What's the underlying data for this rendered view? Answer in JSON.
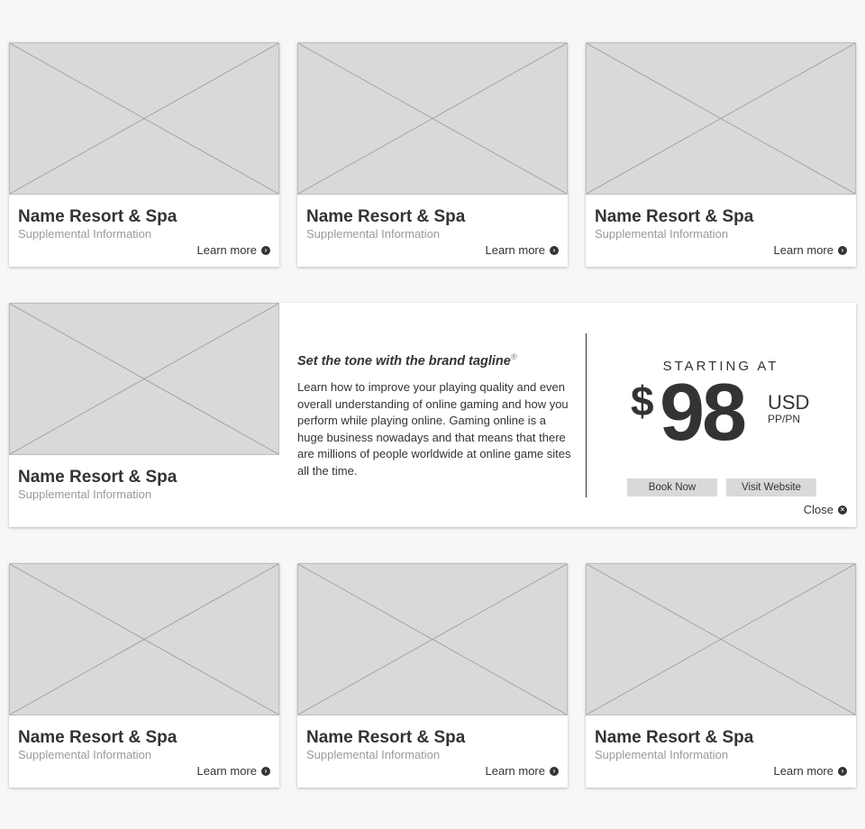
{
  "top_cards": [
    {
      "name": "Name Resort & Spa",
      "supplemental": "Supplemental Information",
      "link": "Learn more"
    },
    {
      "name": "Name Resort & Spa",
      "supplemental": "Supplemental Information",
      "link": "Learn more"
    },
    {
      "name": "Name Resort & Spa",
      "supplemental": "Supplemental Information",
      "link": "Learn more"
    }
  ],
  "expanded": {
    "name": "Name Resort & Spa",
    "supplemental": "Supplemental Information",
    "tagline": "Set the tone with the brand tagline",
    "tagline_mark": "®",
    "description": "Learn how to improve your playing quality and even overall understanding of online gaming and how you perform while playing online. Gaming online is a huge business nowadays and that means that there are millions of people worldwide at online game sites all the time.",
    "starting_label": "STARTING AT",
    "currency_symbol": "$",
    "price": "98",
    "currency": "USD",
    "unit": "PP/PN",
    "book_button": "Book Now",
    "visit_button": "Visit Website",
    "close_label": "Close"
  },
  "bottom_cards": [
    {
      "name": "Name Resort & Spa",
      "supplemental": "Supplemental Information",
      "link": "Learn more"
    },
    {
      "name": "Name Resort & Spa",
      "supplemental": "Supplemental Information",
      "link": "Learn more"
    },
    {
      "name": "Name Resort & Spa",
      "supplemental": "Supplemental Information",
      "link": "Learn more"
    }
  ],
  "icons": {
    "learn_more": "chevron-circle-right-icon",
    "close": "close-circle-icon"
  },
  "colors": {
    "placeholder": "#d9d9d9",
    "text": "#333333",
    "muted": "#9a9a9a",
    "background": "#f7f7f7"
  }
}
